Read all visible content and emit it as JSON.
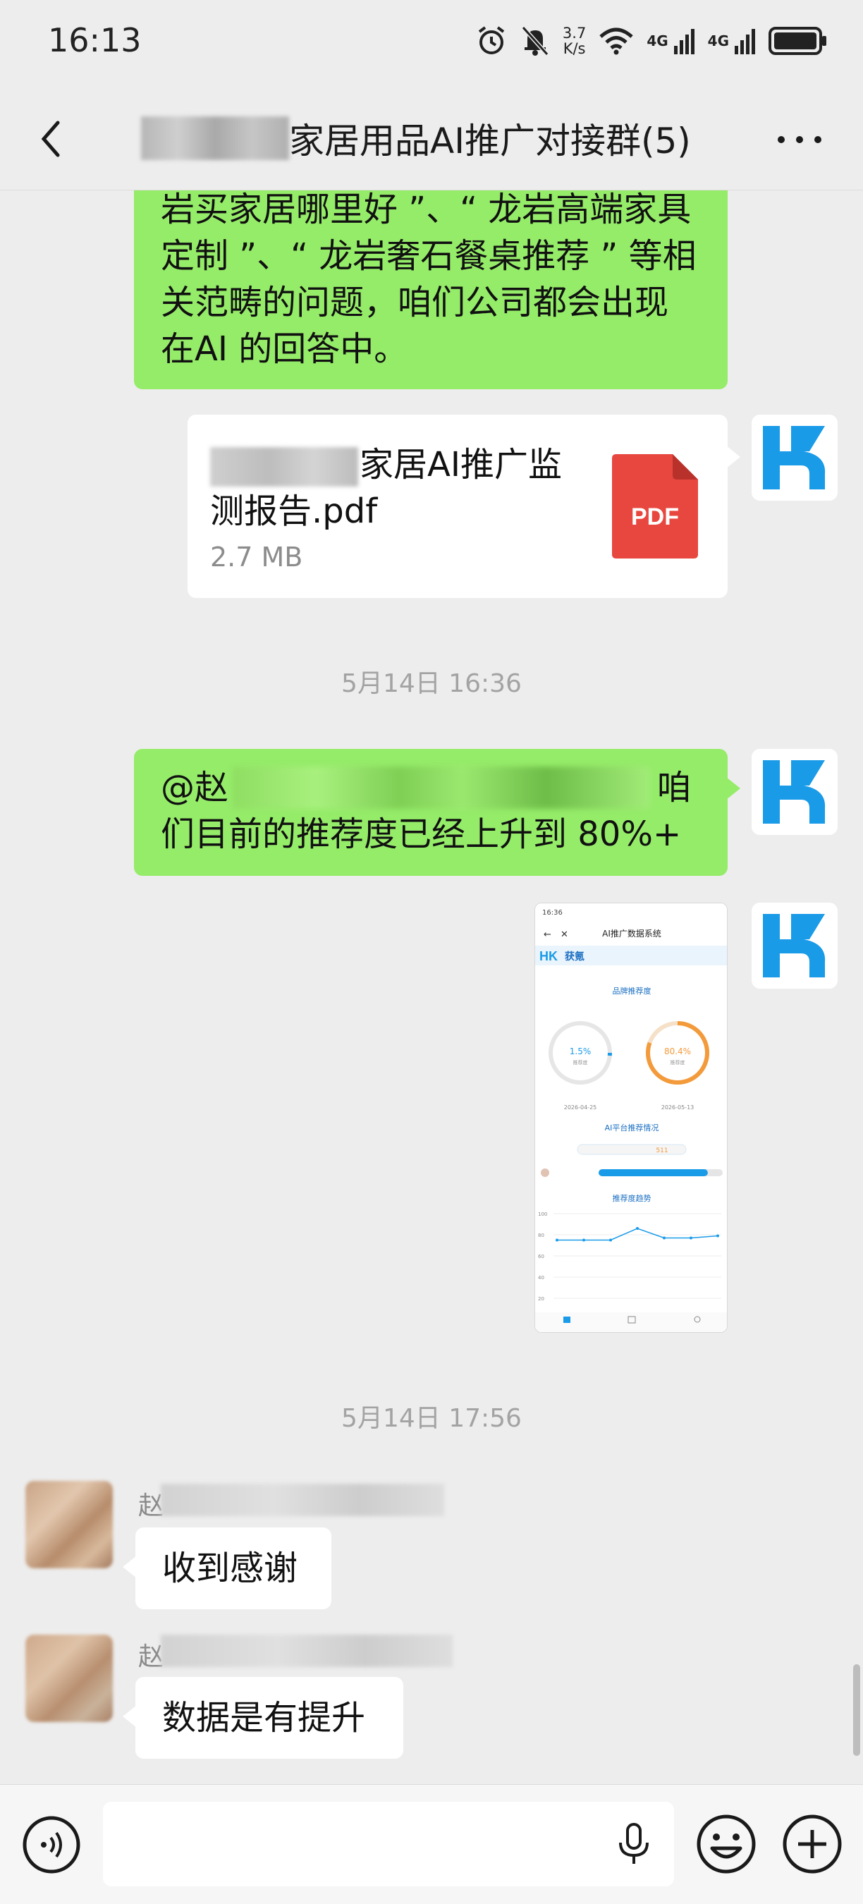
{
  "status_bar": {
    "time": "16:13",
    "net_speed_value": "3.7",
    "net_speed_unit": "K/s",
    "net_tag_1": "4G",
    "net_tag_2": "4G",
    "icons": [
      "alarm-icon",
      "mute-icon",
      "wifi-icon",
      "signal-icon",
      "battery-icon"
    ]
  },
  "header": {
    "title": "家居用品AI推广对接群(5)",
    "back_icon": "chevron-left-icon",
    "more_icon": "more-icon"
  },
  "messages": {
    "m1": {
      "line1": "岩买家居哪里好 ”、“ 龙岩高端家具",
      "line2": "定制 ”、“ 龙岩奢石餐桌推荐 ” 等相",
      "line3": "关范畴的问题，咱们公司都会出现",
      "line4": "在AI 的回答中。"
    },
    "file": {
      "name_part1": "家居AI推广监",
      "name_part2": "测报告.pdf",
      "size": "2.7 MB",
      "type_label": "PDF"
    },
    "time1": "5月14日 16:36",
    "m2": {
      "at": "@赵",
      "tail": "咱",
      "line2": "们目前的推荐度已经上升到 80%+"
    },
    "time2": "5月14日 17:56",
    "m3": {
      "sender_initial": "赵",
      "text": "收到感谢"
    },
    "m4": {
      "sender_initial": "赵",
      "text": "数据是有提升"
    }
  },
  "screenshot": {
    "time": "16:36",
    "title": "AI推广数据系统",
    "brand": "获氪",
    "section1": "品牌推荐度",
    "left_value": "1.5%",
    "left_label": "推荐度",
    "right_value": "80.4%",
    "right_label": "推荐度",
    "left_date": "2026-04-25",
    "right_date": "2026-05-13",
    "section2": "AI平台推荐情况",
    "platform_count": "511",
    "section3": "推荐度趋势",
    "y_ticks": [
      "100",
      "80",
      "60",
      "40",
      "20"
    ],
    "trend": [
      75,
      75,
      75,
      86,
      77,
      77,
      79
    ],
    "progress": 0.88
  },
  "input_bar": {
    "icons": [
      "voice-icon",
      "mic-icon",
      "emoji-icon",
      "add-icon"
    ]
  },
  "colors": {
    "green_bubble": "#95ec69",
    "hk_blue": "#1a9be8",
    "pdf_red": "#e8473f",
    "orange": "#f39a3b"
  }
}
